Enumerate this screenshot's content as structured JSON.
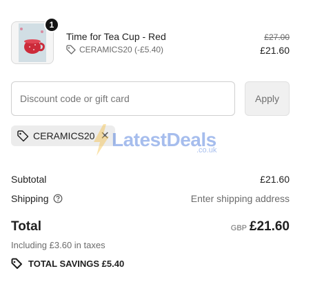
{
  "product": {
    "quantity": "1",
    "name": "Time for Tea Cup - Red",
    "discount_tag": "CERAMICS20 (-£5.40)",
    "original_price": "£27.00",
    "price": "£21.60",
    "image_icon": "red-teacup-thumbnail"
  },
  "discount": {
    "placeholder": "Discount code or gift card",
    "apply_label": "Apply",
    "applied_code": "CERAMICS20"
  },
  "watermark": {
    "brand": "LatestDeals",
    "domain": ".co.uk"
  },
  "summary": {
    "subtotal_label": "Subtotal",
    "subtotal_value": "£21.60",
    "shipping_label": "Shipping",
    "shipping_value": "Enter shipping address",
    "total_label": "Total",
    "currency": "GBP",
    "total_value": "£21.60",
    "tax_note": "Including £3.60 in taxes",
    "savings_label": "TOTAL SAVINGS £5.40"
  },
  "colors": {
    "accent_watermark": "#3b6fd9",
    "badge_bg": "#141414"
  }
}
